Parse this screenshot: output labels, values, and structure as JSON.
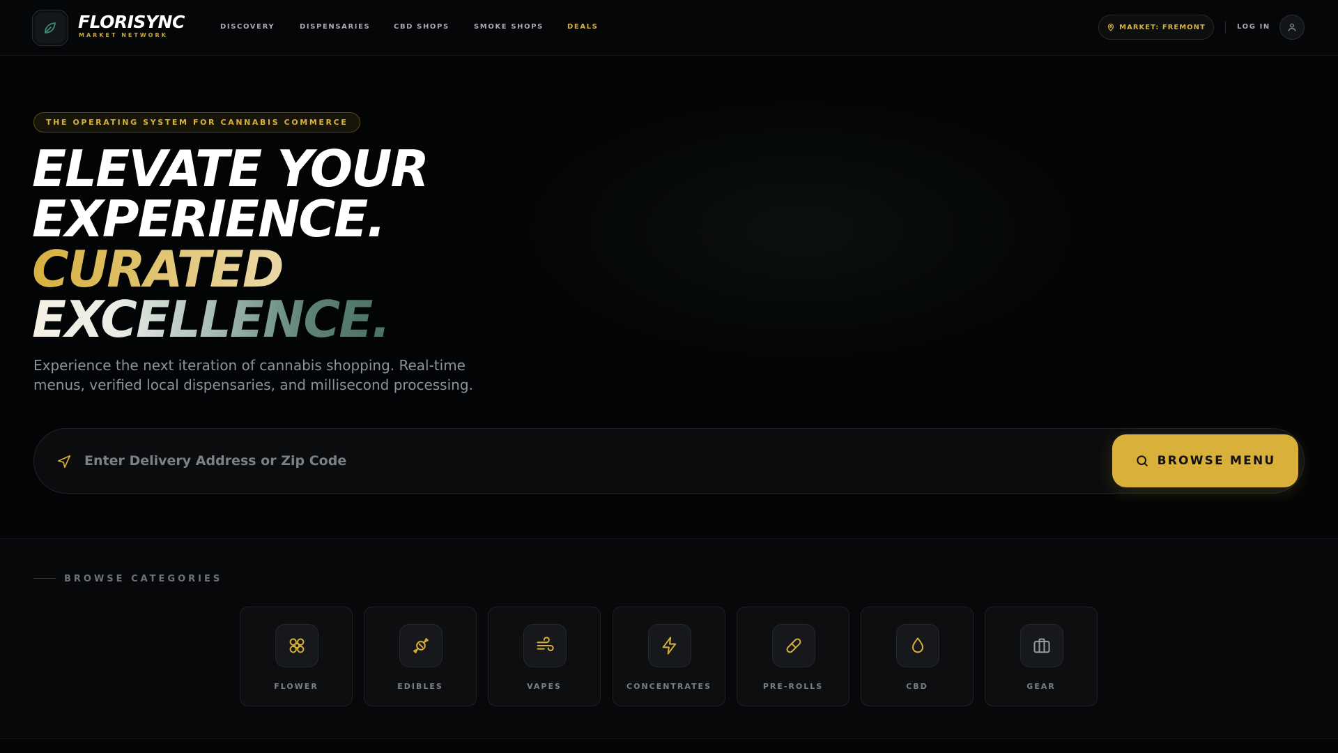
{
  "brand": {
    "name": "FLORISYNC",
    "subtitle": "MARKET NETWORK",
    "logo_icon": "leaf-icon"
  },
  "nav": {
    "links": [
      {
        "label": "DISCOVERY"
      },
      {
        "label": "DISPENSARIES"
      },
      {
        "label": "CBD SHOPS"
      },
      {
        "label": "SMOKE SHOPS"
      },
      {
        "label": "DEALS",
        "highlight": true
      }
    ],
    "market_label": "MARKET: FREMONT",
    "login_label": "LOG IN"
  },
  "hero": {
    "tagline": "THE OPERATING SYSTEM FOR CANNABIS COMMERCE",
    "headline_lines": [
      "ELEVATE YOUR",
      "EXPERIENCE.",
      "CURATED",
      "EXCELLENCE."
    ],
    "subtitle": "Experience the next iteration of cannabis shopping. Real-time menus, verified local dispensaries, and millisecond processing."
  },
  "search": {
    "placeholder": "Enter Delivery Address or Zip Code",
    "value": "",
    "button_label": "BROWSE MENU"
  },
  "categories": {
    "section_label": "BROWSE CATEGORIES",
    "items": [
      {
        "label": "FLOWER",
        "icon": "flower-icon"
      },
      {
        "label": "EDIBLES",
        "icon": "candy-icon"
      },
      {
        "label": "VAPES",
        "icon": "wind-icon"
      },
      {
        "label": "CONCENTRATES",
        "icon": "lightning-icon"
      },
      {
        "label": "PRE-ROLLS",
        "icon": "pill-icon"
      },
      {
        "label": "CBD",
        "icon": "droplet-icon"
      },
      {
        "label": "GEAR",
        "icon": "briefcase-icon"
      }
    ]
  },
  "colors": {
    "accent_gold": "#d9b13a",
    "background": "#030405",
    "accent_green": "#3f6b5c"
  }
}
